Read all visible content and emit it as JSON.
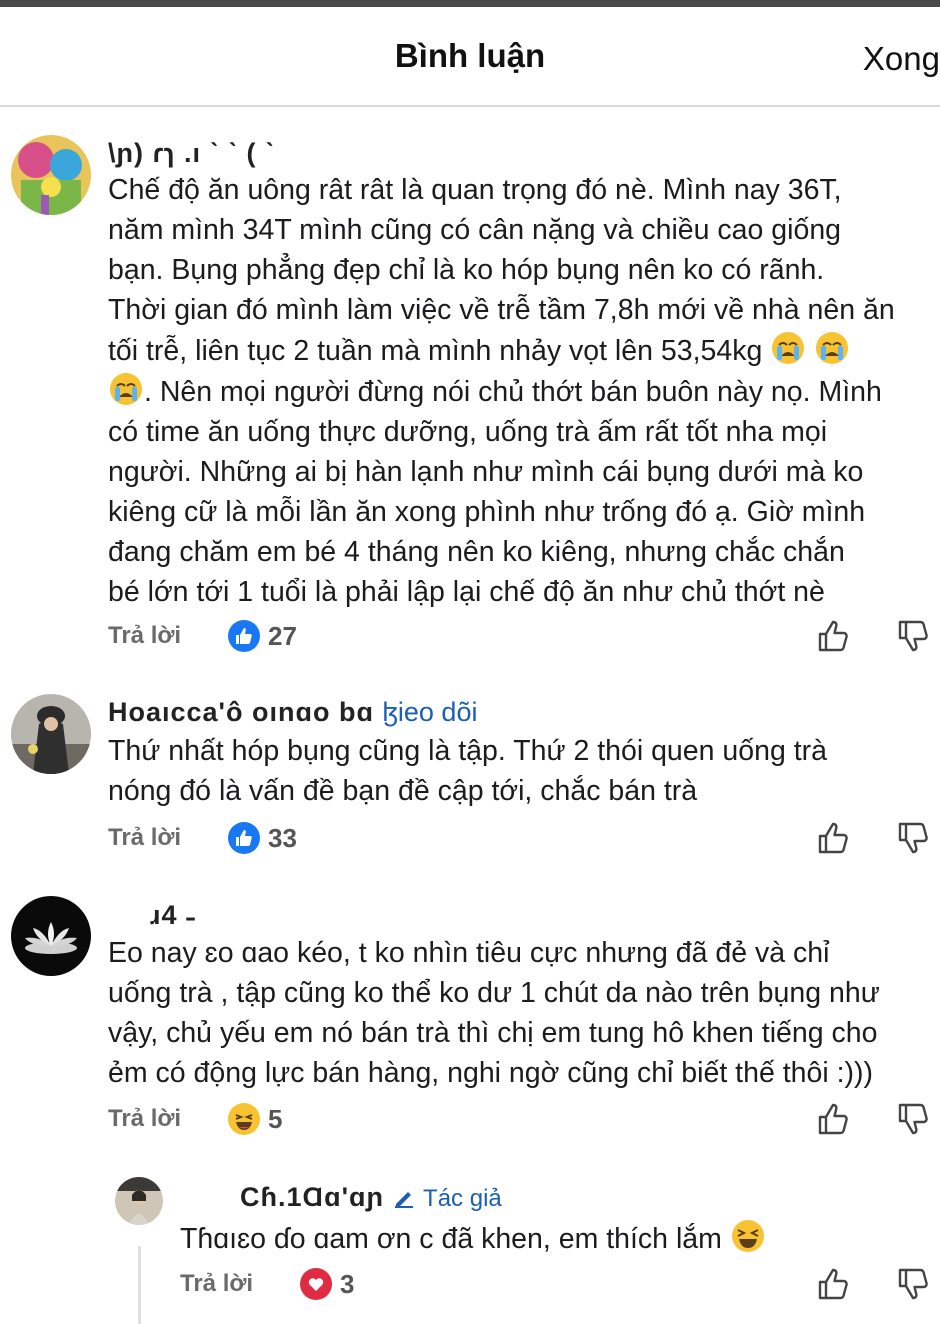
{
  "header": {
    "title": "Bình luận",
    "done_label": "Xong"
  },
  "comments": [
    {
      "name": "\\ɲ) ɾɿ .ı ˋ ˋ ( ˋ",
      "lines": [
        "Chế độ ăn uông rât rât là quan trọng đó nè. Mình nay 36T,",
        "năm mình 34T mình cũng có cân nặng và chiều cao giống",
        "bạn. Bụng phẳng đẹp chỉ là ko hóp bụng nên ko có rãnh.",
        "Thời gian đó mình làm việc về trễ tầm 7,8h mới về nhà nên ăn",
        "tối trễ, liên tục 2 tuần mà mình nhảy vọt lên 53,54kg",
        ". Nên mọi người đừng nói chủ thớt bán buôn này nọ. Mình",
        "có time ăn uống thực dưỡng, uống trà ấm rất tốt nha mọi",
        "người. Những ai bị hàn lạnh như mình cái bụng dưới mà ko",
        "kiêng cữ là mỗi lần ăn xong phình như trống đó ạ. Giờ mình",
        "đang chăm em bé 4 tháng nên ko kiêng, nhưng chắc chắn",
        "bé lớn tới 1 tuổi là phải lập lại chế độ ăn như chủ thớt nè"
      ],
      "reply_label": "Trả lời",
      "reaction": "like",
      "count": "27"
    },
    {
      "name": "Hoaıcca'ô oınɑo bɑ",
      "follow": "ɮieo dõi",
      "lines": [
        "Thứ nhất hóp bụng cũng là tập. Thứ 2 thói quen uống trà",
        "nóng đó là vấn đề bạn đề cập tới, chắc bán trà"
      ],
      "reply_label": "Trả lời",
      "reaction": "like",
      "count": "33"
    },
    {
      "name": "ɹ4 ˗",
      "lines": [
        "Eo nay ɛo ɑao kéo, t ko nhìn tiêu cực nhưng đã đẻ và chỉ",
        "uống trà , tập cũng ko thể ko dư 1 chút da nào trên bụng như",
        "vậy, chủ yếu em nó bán trà thì chị em tung hô khen tiếng cho",
        "ẻm có động lực bán hàng, nghi ngờ cũng chỉ biết thế thôi :)))"
      ],
      "reply_label": "Trả lời",
      "reaction": "haha",
      "count": "5"
    },
    {
      "name": "Cɦ.1Ɑɑ'ɑɲ",
      "author": "Tác giả",
      "lines": [
        "Tɦɑıɛo ɗo ɑam ơn c đã khen, em thích lắm"
      ],
      "reply_label": "Trả lời",
      "reaction": "love",
      "count": "3"
    }
  ],
  "icons": {
    "like": "thumbs-up",
    "dislike": "thumbs-down",
    "cry": "crying-face-emoji",
    "laugh": "laughing-face-emoji"
  },
  "colors": {
    "like": "#1877f2",
    "love": "#e02c43",
    "haha": "#f7c332",
    "link": "#1a5fb4"
  }
}
